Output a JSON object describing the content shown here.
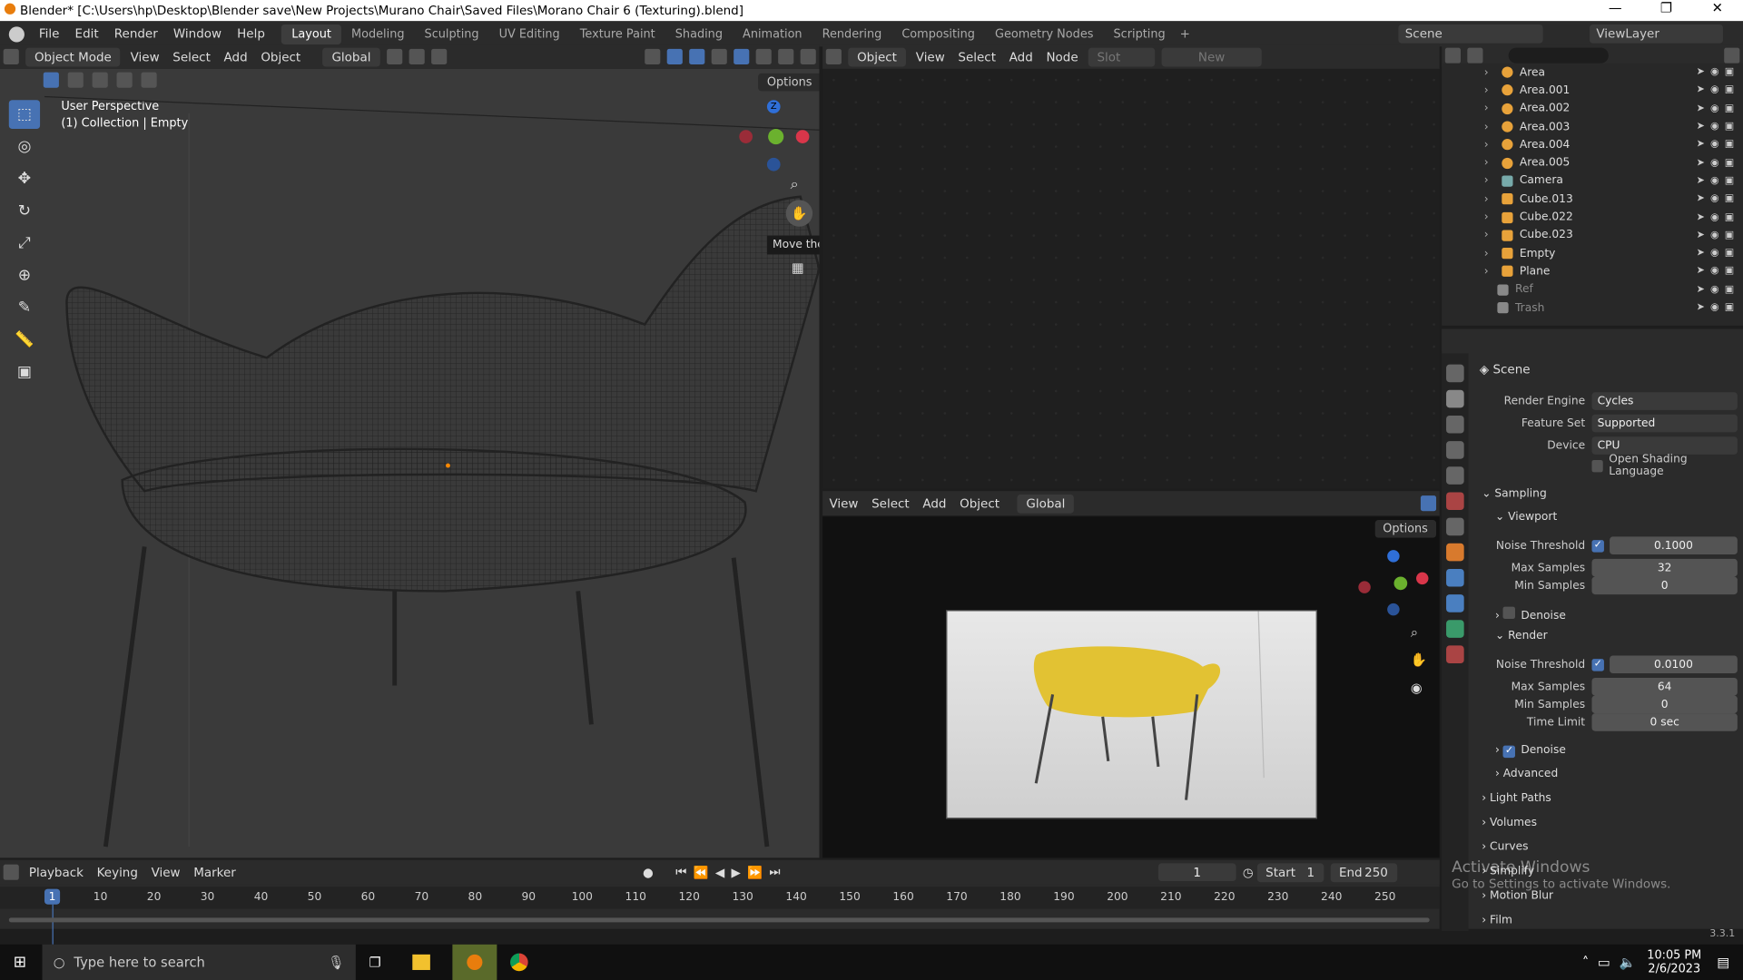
{
  "title_bar": {
    "text": "Blender* [C:\\Users\\hp\\Desktop\\Blender save\\New Projects\\Murano Chair\\Saved Files\\Morano Chair 6 (Texturing).blend]",
    "min": "—",
    "max": "❐",
    "close": "✕"
  },
  "menu": [
    "File",
    "Edit",
    "Render",
    "Window",
    "Help"
  ],
  "workspaces": [
    "Layout",
    "Modeling",
    "Sculpting",
    "UV Editing",
    "Texture Paint",
    "Shading",
    "Animation",
    "Rendering",
    "Compositing",
    "Geometry Nodes",
    "Scripting"
  ],
  "active_workspace": "Layout",
  "scene_name": "Scene",
  "view_layer": "ViewLayer",
  "viewport": {
    "mode": "Object Mode",
    "menus": [
      "View",
      "Select",
      "Add",
      "Object"
    ],
    "orientation": "Global",
    "options_label": "Options",
    "overlay_line1": "User Perspective",
    "overlay_line2": "(1) Collection | Empty",
    "tooltip": "Move the view",
    "gizmo_z": "Z"
  },
  "node_editor": {
    "type": "Object",
    "menus": [
      "View",
      "Select",
      "Add",
      "Node"
    ],
    "slot": "Slot",
    "new_label": "New"
  },
  "camera_view": {
    "menus": [
      "View",
      "Select",
      "Add",
      "Object"
    ],
    "orientation": "Global",
    "options_label": "Options"
  },
  "outliner": {
    "items": [
      {
        "name": "Area",
        "type": "light"
      },
      {
        "name": "Area.001",
        "type": "light"
      },
      {
        "name": "Area.002",
        "type": "light"
      },
      {
        "name": "Area.003",
        "type": "light"
      },
      {
        "name": "Area.004",
        "type": "light"
      },
      {
        "name": "Area.005",
        "type": "light"
      },
      {
        "name": "Camera",
        "type": "camera"
      },
      {
        "name": "Cube.013",
        "type": "mesh"
      },
      {
        "name": "Cube.022",
        "type": "mesh"
      },
      {
        "name": "Cube.023",
        "type": "mesh"
      },
      {
        "name": "Empty",
        "type": "empty"
      },
      {
        "name": "Plane",
        "type": "mesh"
      },
      {
        "name": "Ref",
        "type": "collection"
      },
      {
        "name": "Trash",
        "type": "collection"
      }
    ]
  },
  "properties": {
    "context": "Scene",
    "render_engine_label": "Render Engine",
    "render_engine": "Cycles",
    "feature_set_label": "Feature Set",
    "feature_set": "Supported",
    "device_label": "Device",
    "device": "CPU",
    "osl_label": "Open Shading Language",
    "sampling": "Sampling",
    "viewport": "Viewport",
    "noise_threshold_label": "Noise Threshold",
    "vp_noise": "0.1000",
    "max_samples_label": "Max Samples",
    "vp_max": "32",
    "min_samples_label": "Min Samples",
    "vp_min": "0",
    "denoise_label": "Denoise",
    "render": "Render",
    "r_noise": "0.0100",
    "r_max": "64",
    "r_min": "0",
    "time_limit_label": "Time Limit",
    "time_limit": "0 sec",
    "advanced": "Advanced",
    "light_paths": "Light Paths",
    "volumes": "Volumes",
    "curves": "Curves",
    "simplify": "Simplify",
    "motion_blur": "Motion Blur",
    "film": "Film"
  },
  "timeline": {
    "menus": [
      "Playback",
      "Keying",
      "View",
      "Marker"
    ],
    "current_frame": "1",
    "start_label": "Start",
    "start": "1",
    "end_label": "End",
    "end": "250",
    "ticks": [
      "1",
      "10",
      "20",
      "30",
      "40",
      "50",
      "60",
      "70",
      "80",
      "90",
      "100",
      "110",
      "120",
      "130",
      "140",
      "150",
      "160",
      "170",
      "180",
      "190",
      "200",
      "210",
      "220",
      "230",
      "240",
      "250"
    ]
  },
  "activate_windows": {
    "line1": "Activate Windows",
    "line2": "Go to Settings to activate Windows."
  },
  "version": "3.3.1",
  "taskbar": {
    "search_placeholder": "Type here to search",
    "time": "10:05 PM",
    "date": "2/6/2023"
  }
}
